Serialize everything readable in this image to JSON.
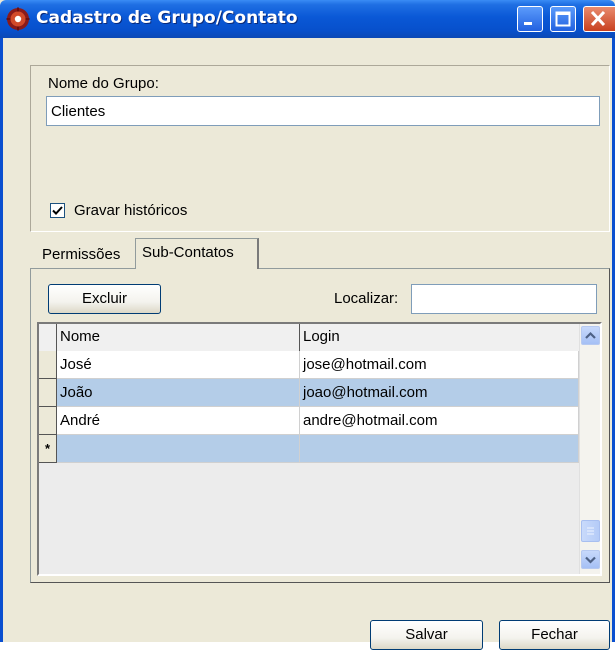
{
  "window": {
    "title": "Cadastro de Grupo/Contato",
    "minimize_icon": "minimize-icon",
    "maximize_icon": "maximize-icon",
    "close_icon": "close-icon",
    "app_icon": "app-gear-icon"
  },
  "group": {
    "name_label": "Nome do Grupo:",
    "name_value": "Clientes",
    "history_checkbox_label": "Gravar históricos",
    "history_checked": true
  },
  "tabs": [
    {
      "label": "Permissões",
      "active": false
    },
    {
      "label": "Sub-Contatos",
      "active": true
    }
  ],
  "subcontacts": {
    "delete_button": "Excluir",
    "search_label": "Localizar:",
    "search_value": "",
    "columns": [
      "Nome",
      "Login"
    ],
    "rows": [
      {
        "nome": "José",
        "login": "jose@hotmail.com",
        "selected": false
      },
      {
        "nome": "João",
        "login": "joao@hotmail.com",
        "selected": true
      },
      {
        "nome": "André",
        "login": "andre@hotmail.com",
        "selected": false
      }
    ],
    "new_row_marker": "*"
  },
  "footer": {
    "save_button": "Salvar",
    "close_button": "Fechar"
  },
  "colors": {
    "titlebar": "#0a58d6",
    "window_bg": "#ece9d8",
    "selected_row": "#b4cde8"
  }
}
